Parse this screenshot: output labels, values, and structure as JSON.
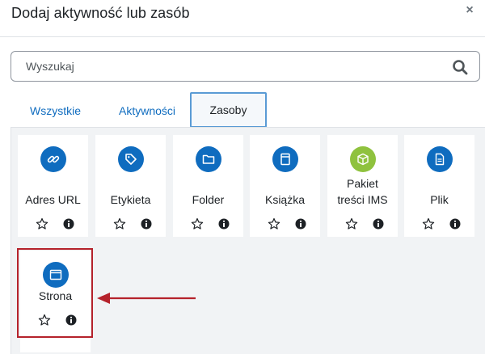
{
  "dialog": {
    "title": "Dodaj aktywność lub zasób",
    "close_label": "×"
  },
  "search": {
    "placeholder": "Wyszukaj",
    "value": ""
  },
  "tabs": [
    {
      "label": "Wszystkie",
      "active": false
    },
    {
      "label": "Aktywności",
      "active": false
    },
    {
      "label": "Zasoby",
      "active": true
    }
  ],
  "resources": [
    {
      "label": "Adres URL",
      "icon": "link-icon",
      "color": "#0f6cbf"
    },
    {
      "label": "Etykieta",
      "icon": "tag-icon",
      "color": "#0f6cbf"
    },
    {
      "label": "Folder",
      "icon": "folder-icon",
      "color": "#0f6cbf"
    },
    {
      "label": "Książka",
      "icon": "book-icon",
      "color": "#0f6cbf"
    },
    {
      "label": "Pakiet treści IMS",
      "icon": "package-icon",
      "color": "#8fc23e"
    },
    {
      "label": "Plik",
      "icon": "file-icon",
      "color": "#0f6cbf"
    },
    {
      "label": "Strona",
      "icon": "page-icon",
      "color": "#0f6cbf"
    }
  ],
  "colors": {
    "link": "#0f6cbf",
    "highlight": "#b5222b",
    "active_tab_border": "#5a9bd5",
    "background": "#f1f3f5"
  }
}
